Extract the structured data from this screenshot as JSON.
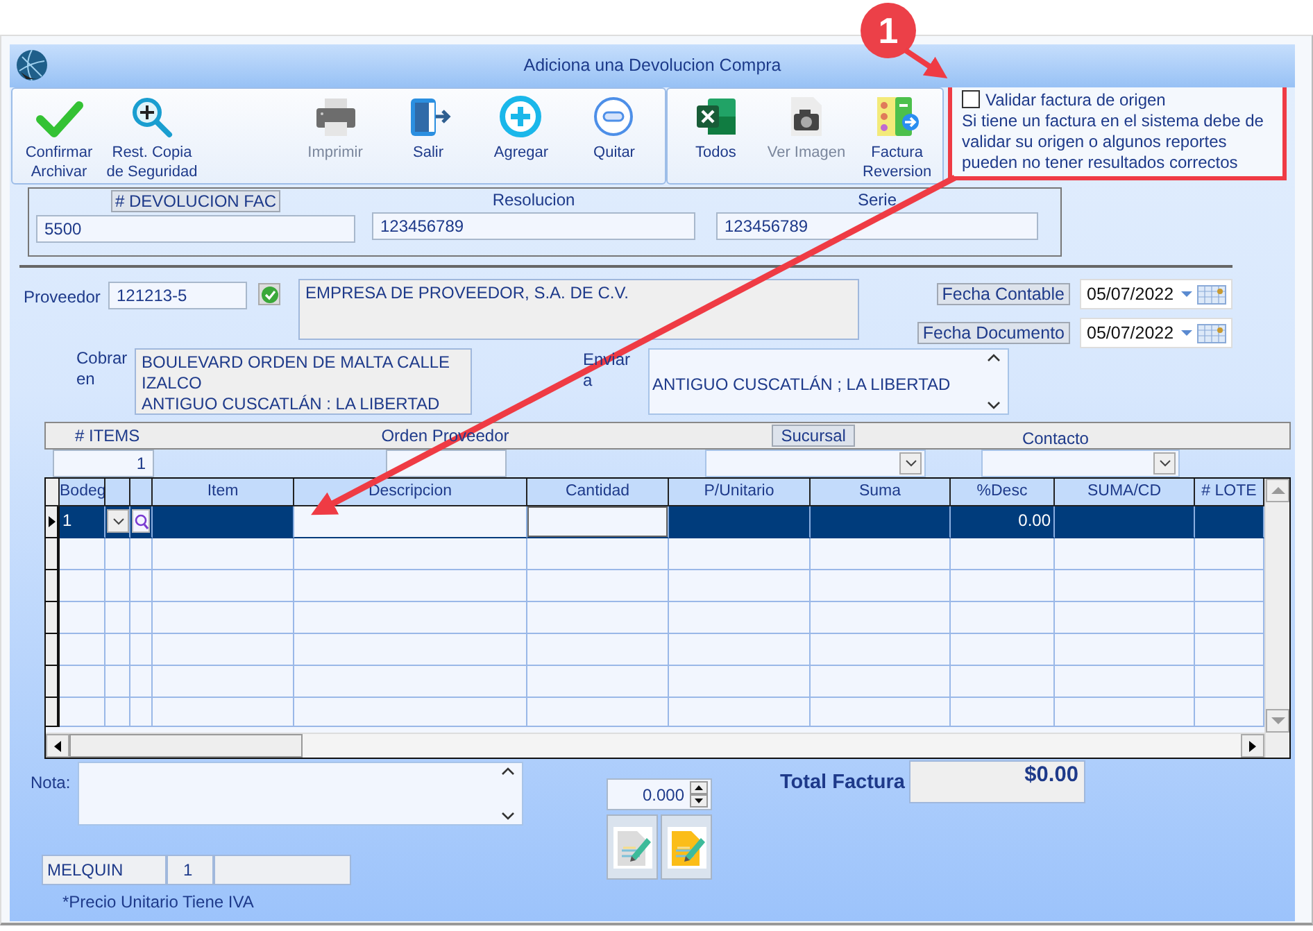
{
  "window": {
    "title": "Adiciona una Devolucion Compra"
  },
  "toolbar": {
    "groups": [
      {
        "buttons": [
          {
            "kind": "check",
            "label": "Confirmar\nArchivar",
            "disabled": false
          },
          {
            "kind": "zoom",
            "label": "Rest. Copia\nde Seguridad",
            "disabled": false
          },
          {
            "kind": "printer",
            "label": "Imprimir",
            "disabled": true
          },
          {
            "kind": "exit",
            "label": "Salir",
            "disabled": false
          },
          {
            "kind": "plus",
            "label": "Agregar",
            "disabled": false
          },
          {
            "kind": "minus",
            "label": "Quitar",
            "disabled": false
          }
        ]
      },
      {
        "buttons": [
          {
            "kind": "excel",
            "label": "Todos",
            "disabled": false
          },
          {
            "kind": "camera",
            "label": "Ver Imagen",
            "disabled": true
          },
          {
            "kind": "report",
            "label": "Factura\nReversion",
            "disabled": false
          }
        ]
      }
    ]
  },
  "validation": {
    "label": "Validar factura de origen",
    "checked": false,
    "note": "Si tiene un factura en el sistema debe de validar su origen o algunos reportes pueden no tener resultados correctos"
  },
  "annotation": {
    "number": "1"
  },
  "header": {
    "fields": [
      {
        "label": "# DEVOLUCION FAC",
        "boxed": true,
        "value": "5500"
      },
      {
        "label": "Resolucion",
        "boxed": false,
        "value": "123456789"
      },
      {
        "label": "Serie",
        "boxed": false,
        "value": "123456789"
      }
    ]
  },
  "proveedor": {
    "label": "Proveedor",
    "code": "121213-5",
    "name": "EMPRESA DE PROVEEDOR, S.A. DE C.V."
  },
  "dates": [
    {
      "label": "Fecha Contable",
      "value": "05/07/2022"
    },
    {
      "label": "Fecha Documento",
      "value": "05/07/2022"
    }
  ],
  "cobrar": {
    "label": "Cobrar en",
    "text": "BOULEVARD ORDEN DE MALTA CALLE IZALCO\nANTIGUO CUSCATLÁN : LA LIBERTAD"
  },
  "enviar": {
    "label": "Enviar a",
    "text": "ANTIGUO CUSCATLÁN ; LA LIBERTAD"
  },
  "band": {
    "items_label": "# ITEMS",
    "items": "1",
    "orden_label": "Orden Proveedor",
    "sucursal_label": "Sucursal",
    "contacto_label": "Contacto"
  },
  "grid": {
    "columns": [
      {
        "kind": "text",
        "label": "Bodeg",
        "editable": false
      },
      {
        "kind": "dropdown",
        "editable": false
      },
      {
        "kind": "lookup",
        "editable": false
      },
      {
        "kind": "text",
        "label": "Item",
        "editable": false
      },
      {
        "kind": "text",
        "label": "Descripcion",
        "editable": true
      },
      {
        "kind": "text",
        "label": "Cantidad",
        "editable": true
      },
      {
        "kind": "text",
        "label": "P/Unitario",
        "editable": false
      },
      {
        "kind": "text",
        "label": "Suma",
        "editable": false
      },
      {
        "kind": "text",
        "label": "%Desc",
        "editable": false
      },
      {
        "kind": "text",
        "label": "SUMA/CD",
        "editable": false
      },
      {
        "kind": "text",
        "label": "# LOTE",
        "editable": false
      }
    ],
    "rows": [
      {
        "selected": true,
        "cells": [
          "1",
          null,
          null,
          null,
          null,
          null,
          null,
          null,
          "0.00",
          null,
          null
        ]
      }
    ]
  },
  "nota": {
    "label": "Nota:"
  },
  "spinner": {
    "value": "0.000"
  },
  "total": {
    "label": "Total Factura",
    "value": "$0.00"
  },
  "status": {
    "user": "MELQUIN",
    "number": "1"
  },
  "footnote": "*Precio Unitario Tiene IVA"
}
